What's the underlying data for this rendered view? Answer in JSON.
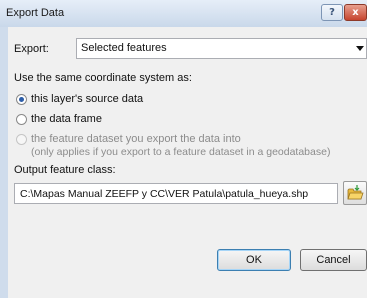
{
  "window": {
    "title": "Export Data",
    "help_label": "?",
    "close_label": "x"
  },
  "export": {
    "label": "Export:",
    "selected": "Selected features"
  },
  "coordinate_system": {
    "heading": "Use the same coordinate system as:",
    "options": [
      {
        "label": "this layer's source data",
        "checked": true,
        "enabled": true
      },
      {
        "label": "the data frame",
        "checked": false,
        "enabled": true
      },
      {
        "label": "the feature dataset you export the data into",
        "sublabel": "(only applies if you export to a feature dataset in a geodatabase)",
        "checked": false,
        "enabled": false
      }
    ]
  },
  "output": {
    "label": "Output feature class:",
    "path": "C:\\Mapas Manual ZEEFP y CC\\VER Patula\\patula_hueya.shp"
  },
  "buttons": {
    "ok": "OK",
    "cancel": "Cancel"
  }
}
